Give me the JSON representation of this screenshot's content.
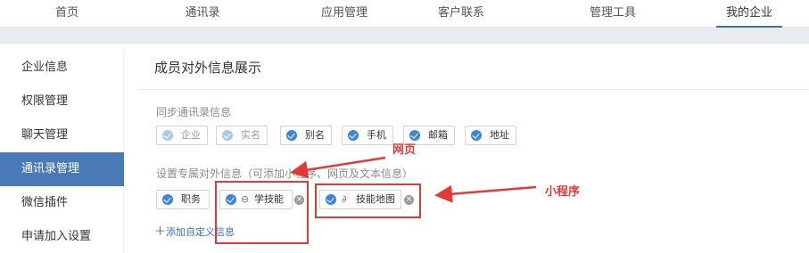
{
  "nav": {
    "items": [
      {
        "label": "首页"
      },
      {
        "label": "通讯录"
      },
      {
        "label": "应用管理"
      },
      {
        "label": "客户联系"
      },
      {
        "label": "管理工具"
      },
      {
        "label": "我的企业"
      }
    ],
    "active_index": 5
  },
  "sidebar": {
    "items": [
      {
        "label": "企业信息"
      },
      {
        "label": "权限管理"
      },
      {
        "label": "聊天管理"
      },
      {
        "label": "通讯录管理"
      },
      {
        "label": "微信插件"
      },
      {
        "label": "申请加入设置"
      }
    ],
    "active_index": 3
  },
  "main": {
    "title": "成员对外信息展示",
    "sync_label": "同步通讯录信息",
    "sync_tags": [
      {
        "label": "企业",
        "checked": true,
        "disabled": true
      },
      {
        "label": "实名",
        "checked": true,
        "disabled": true
      },
      {
        "label": "别名",
        "checked": true,
        "disabled": false
      },
      {
        "label": "手机",
        "checked": true,
        "disabled": false
      },
      {
        "label": "邮箱",
        "checked": true,
        "disabled": false
      },
      {
        "label": "地址",
        "checked": true,
        "disabled": false
      }
    ],
    "custom_label": "设置专属对外信息（可添加小程序、网页及文本信息）",
    "custom_tags": [
      {
        "label": "职务",
        "type": "text",
        "icon": ""
      },
      {
        "label": "学技能",
        "type": "webpage",
        "icon": "link-icon"
      },
      {
        "label": "技能地图",
        "type": "mini-program",
        "icon": "mini-program-icon"
      }
    ],
    "add_link": "添加自定义信息"
  },
  "annotations": {
    "webpage_label": "网页",
    "mini_program_label": "小程序",
    "color": "#e53935"
  },
  "colors": {
    "accent": "#3a86d8",
    "sidebar_active": "#4a79b8",
    "annotation": "#e53935"
  }
}
